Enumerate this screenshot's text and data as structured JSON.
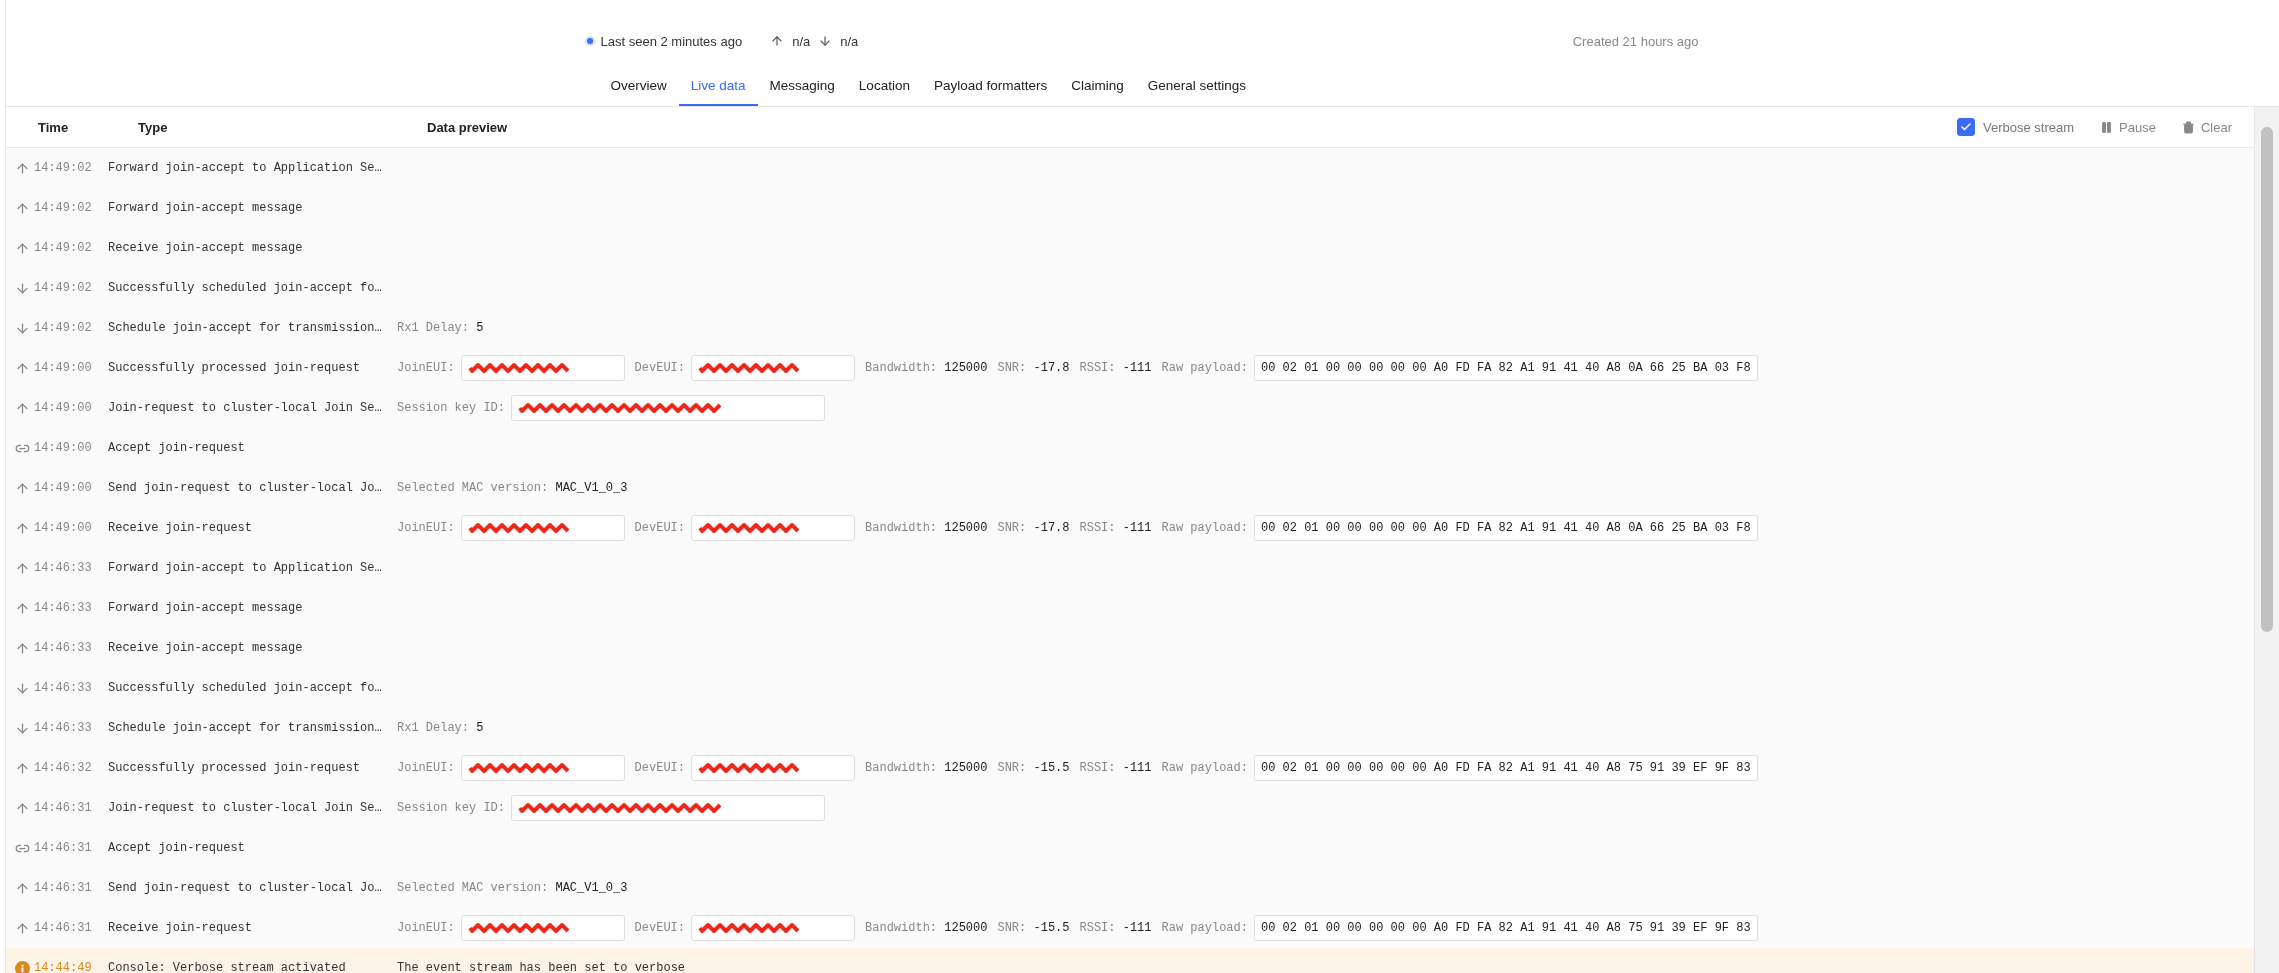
{
  "device": {
    "last_seen": "Last seen 2 minutes ago",
    "online": true,
    "uplink": "n/a",
    "downlink": "n/a",
    "created": "Created 21 hours ago"
  },
  "tabs": [
    {
      "label": "Overview",
      "selected": false
    },
    {
      "label": "Live data",
      "selected": true
    },
    {
      "label": "Messaging",
      "selected": false
    },
    {
      "label": "Location",
      "selected": false
    },
    {
      "label": "Payload formatters",
      "selected": false
    },
    {
      "label": "Claiming",
      "selected": false
    },
    {
      "label": "General settings",
      "selected": false
    }
  ],
  "table": {
    "columns": [
      "Time",
      "Type",
      "Data preview"
    ],
    "controls": {
      "verbose": {
        "label": "Verbose stream",
        "checked": true
      },
      "pause": "Pause",
      "clear": "Clear"
    },
    "rows": [
      {
        "kind": "up",
        "time": "14:49:02",
        "type": "Forward join-accept to Application Se…",
        "preview": []
      },
      {
        "kind": "up",
        "time": "14:49:02",
        "type": "Forward join-accept message",
        "preview": []
      },
      {
        "kind": "up",
        "time": "14:49:02",
        "type": "Receive join-accept message",
        "preview": []
      },
      {
        "kind": "down",
        "time": "14:49:02",
        "type": "Successfully scheduled join-accept fo…",
        "preview": []
      },
      {
        "kind": "down",
        "time": "14:49:02",
        "type": "Schedule join-accept for transmission…",
        "preview": [
          {
            "kind": "value",
            "label": "Rx1 Delay:",
            "value": "5"
          }
        ]
      },
      {
        "kind": "up",
        "time": "14:49:00",
        "type": "Successfully processed join-request",
        "preview": [
          {
            "kind": "hidden-eui",
            "label": "JoinEUI:"
          },
          {
            "kind": "hidden-eui",
            "label": "DevEUI:"
          },
          {
            "kind": "value",
            "label": "Bandwidth:",
            "value": "125000"
          },
          {
            "kind": "value",
            "label": "SNR:",
            "value": "-17.8"
          },
          {
            "kind": "value",
            "label": "RSSI:",
            "value": "-111"
          },
          {
            "kind": "payload",
            "label": "Raw payload:",
            "value": "00 02 01 00 00 00 00 00 A0 FD FA 82 A1 91 41 40 A8 0A 66 25 BA 03 F8"
          }
        ]
      },
      {
        "kind": "up",
        "time": "14:49:00",
        "type": "Join-request to cluster-local Join Se…",
        "preview": [
          {
            "kind": "hidden-key",
            "label": "Session key ID:"
          }
        ]
      },
      {
        "kind": "link",
        "time": "14:49:00",
        "type": "Accept join-request",
        "preview": []
      },
      {
        "kind": "up",
        "time": "14:49:00",
        "type": "Send join-request to cluster-local Jo…",
        "preview": [
          {
            "kind": "value",
            "label": "Selected MAC version:",
            "value": "MAC_V1_0_3"
          }
        ]
      },
      {
        "kind": "up",
        "time": "14:49:00",
        "type": "Receive join-request",
        "preview": [
          {
            "kind": "hidden-eui",
            "label": "JoinEUI:"
          },
          {
            "kind": "hidden-eui",
            "label": "DevEUI:"
          },
          {
            "kind": "value",
            "label": "Bandwidth:",
            "value": "125000"
          },
          {
            "kind": "value",
            "label": "SNR:",
            "value": "-17.8"
          },
          {
            "kind": "value",
            "label": "RSSI:",
            "value": "-111"
          },
          {
            "kind": "payload",
            "label": "Raw payload:",
            "value": "00 02 01 00 00 00 00 00 A0 FD FA 82 A1 91 41 40 A8 0A 66 25 BA 03 F8"
          }
        ]
      },
      {
        "kind": "up",
        "time": "14:46:33",
        "type": "Forward join-accept to Application Se…",
        "preview": []
      },
      {
        "kind": "up",
        "time": "14:46:33",
        "type": "Forward join-accept message",
        "preview": []
      },
      {
        "kind": "up",
        "time": "14:46:33",
        "type": "Receive join-accept message",
        "preview": []
      },
      {
        "kind": "down",
        "time": "14:46:33",
        "type": "Successfully scheduled join-accept fo…",
        "preview": []
      },
      {
        "kind": "down",
        "time": "14:46:33",
        "type": "Schedule join-accept for transmission…",
        "preview": [
          {
            "kind": "value",
            "label": "Rx1 Delay:",
            "value": "5"
          }
        ]
      },
      {
        "kind": "up",
        "time": "14:46:32",
        "type": "Successfully processed join-request",
        "preview": [
          {
            "kind": "hidden-eui",
            "label": "JoinEUI:"
          },
          {
            "kind": "hidden-eui",
            "label": "DevEUI:"
          },
          {
            "kind": "value",
            "label": "Bandwidth:",
            "value": "125000"
          },
          {
            "kind": "value",
            "label": "SNR:",
            "value": "-15.5"
          },
          {
            "kind": "value",
            "label": "RSSI:",
            "value": "-111"
          },
          {
            "kind": "payload",
            "label": "Raw payload:",
            "value": "00 02 01 00 00 00 00 00 A0 FD FA 82 A1 91 41 40 A8 75 91 39 EF 9F 83"
          }
        ]
      },
      {
        "kind": "up",
        "time": "14:46:31",
        "type": "Join-request to cluster-local Join Se…",
        "preview": [
          {
            "kind": "hidden-key",
            "label": "Session key ID:"
          }
        ]
      },
      {
        "kind": "link",
        "time": "14:46:31",
        "type": "Accept join-request",
        "preview": []
      },
      {
        "kind": "up",
        "time": "14:46:31",
        "type": "Send join-request to cluster-local Jo…",
        "preview": [
          {
            "kind": "value",
            "label": "Selected MAC version:",
            "value": "MAC_V1_0_3"
          }
        ]
      },
      {
        "kind": "up",
        "time": "14:46:31",
        "type": "Receive join-request",
        "preview": [
          {
            "kind": "hidden-eui",
            "label": "JoinEUI:"
          },
          {
            "kind": "hidden-eui",
            "label": "DevEUI:"
          },
          {
            "kind": "value",
            "label": "Bandwidth:",
            "value": "125000"
          },
          {
            "kind": "value",
            "label": "SNR:",
            "value": "-15.5"
          },
          {
            "kind": "value",
            "label": "RSSI:",
            "value": "-111"
          },
          {
            "kind": "payload",
            "label": "Raw payload:",
            "value": "00 02 01 00 00 00 00 00 A0 FD FA 82 A1 91 41 40 A8 75 91 39 EF 9F 83"
          }
        ]
      },
      {
        "kind": "info",
        "time": "14:44:49",
        "type": "Console: Verbose stream activated",
        "preview": [
          {
            "kind": "message",
            "value": "The event stream has been set to verbose"
          }
        ]
      }
    ]
  }
}
